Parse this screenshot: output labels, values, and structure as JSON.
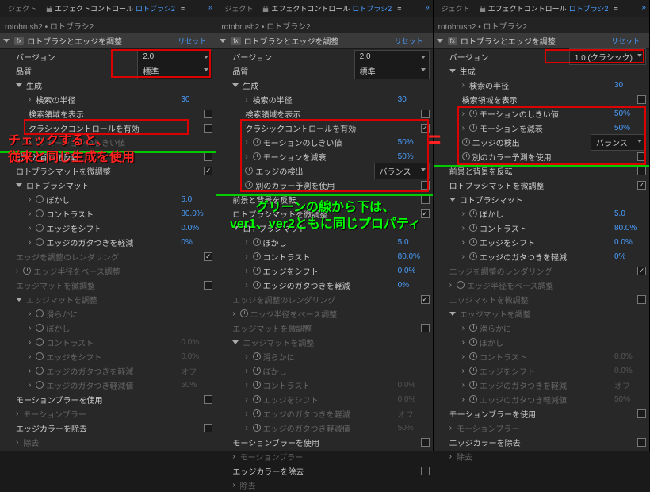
{
  "tabs": {
    "project": "ジェクト",
    "effect_controls": "エフェクトコントロール",
    "layer": "ロトブラシ2"
  },
  "breadcrumb": "rotobrush2 • ロトブラシ2",
  "fx": {
    "badge": "fx",
    "name": "ロトブラシとエッジを調整",
    "reset": "リセット"
  },
  "p1": {
    "version": {
      "label": "バージョン",
      "value": "2.0"
    },
    "quality": {
      "label": "品質",
      "value": "標準"
    },
    "gen": "生成",
    "search_radius": {
      "label": "検索の半径",
      "value": "30"
    },
    "show_search": {
      "label": "検索領域を表示"
    },
    "classic": {
      "label": "クラシックコントロールを有効"
    },
    "motion_thresh": {
      "label": "モーションのしきい値"
    },
    "invert": {
      "label": "前景と背景を反転"
    },
    "fine": {
      "label": "ロトブラシマットを微調整"
    },
    "matte": "ロトブラシマット",
    "blur": {
      "label": "ぼかし",
      "value": "5.0"
    },
    "contrast": {
      "label": "コントラスト",
      "value": "80.0%"
    },
    "shift": {
      "label": "エッジをシフト",
      "value": "0.0%"
    },
    "reduce_chatter": {
      "label": "エッジのガタつきを軽減",
      "value": "0%"
    },
    "edge_render": "エッジを調整のレンダリング",
    "edge_base": "エッジ半径をベース調整",
    "edge_fine": "エッジマットを微調整",
    "edge_matte": "エッジマットを調整",
    "smooth": {
      "label": "滑らかに"
    },
    "blur2": {
      "label": "ぼかし"
    },
    "contrast2": {
      "label": "コントラスト",
      "value": "0.0%"
    },
    "shift2": {
      "label": "エッジをシフト",
      "value": "0.0%"
    },
    "chatter2": {
      "label": "エッジのガタつきを軽減",
      "value": "オフ"
    },
    "chatter_val": {
      "label": "エッジのガタつき軽減値",
      "value": "50%"
    },
    "use_mblur": {
      "label": "モーションブラーを使用"
    },
    "mblur": "モーションブラー",
    "purge": {
      "label": "エッジカラーを除去"
    },
    "purge_grp": "除去"
  },
  "p2": {
    "classic_checked": true,
    "motion_thresh": {
      "label": "モーションのしきい値",
      "value": "50%"
    },
    "motion_damp": {
      "label": "モーションを減衰",
      "value": "50%"
    },
    "edge_detect": {
      "label": "エッジの検出",
      "value": "バランス"
    },
    "alt_color": {
      "label": "別のカラー予測を使用"
    }
  },
  "p3": {
    "version": {
      "value": "1.0 (クラシック)"
    },
    "motion_thresh": {
      "value": "50%"
    },
    "motion_damp": {
      "value": "50%"
    },
    "edge_detect": {
      "value": "バランス"
    }
  },
  "anno": {
    "check": "チェックすると、\n従来と同じ生成を使用",
    "green": "グリーンの線から下は、\nver1、ver2ともに同じプロパティ",
    "eq": "="
  }
}
